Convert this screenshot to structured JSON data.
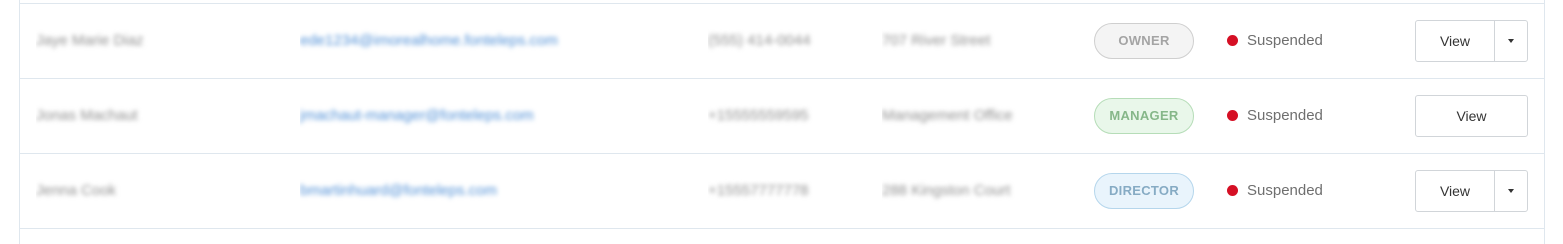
{
  "rows": [
    {
      "name": "Jaye Marie Diaz",
      "email": "ede1234@imorealhome.fonteleps.com",
      "phone": "(555) 414-0044",
      "address": "707 River Street",
      "role": "OWNER",
      "status": "Suspended",
      "action": "View",
      "has_dropdown": true
    },
    {
      "name": "Jonas Machaut",
      "email": "jmachaut-manager@fonteleps.com",
      "phone": "+15555559595",
      "address": "Management Office",
      "role": "MANAGER",
      "status": "Suspended",
      "action": "View",
      "has_dropdown": false
    },
    {
      "name": "Jenna Cook",
      "email": "bmartinhuard@fonteleps.com",
      "phone": "+15557777778",
      "address": "288 Kingston Court",
      "role": "DIRECTOR",
      "status": "Suspended",
      "action": "View",
      "has_dropdown": true
    }
  ],
  "colors": {
    "status_suspended": "#d50f24",
    "owner_badge": "#a4a4a4",
    "manager_badge": "#86b789",
    "director_badge": "#86abc4",
    "email_link": "#4f8fd6"
  }
}
